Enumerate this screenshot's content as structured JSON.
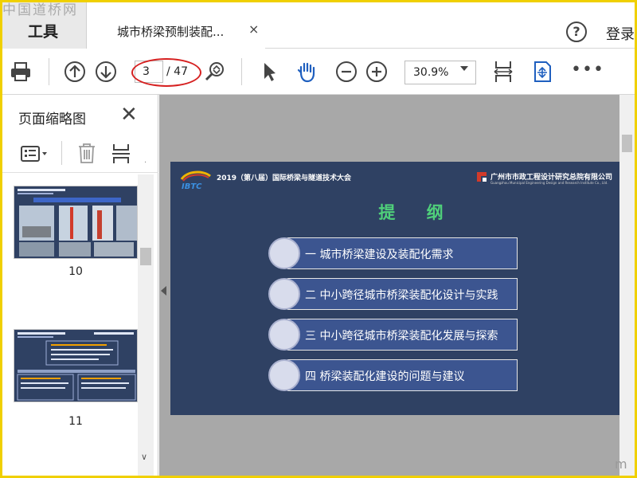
{
  "watermark_top": "中国道桥网",
  "tabs": {
    "tools_label": "工具",
    "document_title": "城市桥梁预制装配...",
    "close_glyph": "×",
    "help_glyph": "?",
    "login_label": "登录"
  },
  "toolbar": {
    "icons": [
      "print-icon",
      "prev-page-icon",
      "next-page-icon",
      "page-zoom-icon",
      "select-arrow-icon",
      "hand-icon",
      "zoom-out-icon",
      "zoom-in-icon",
      "fit-page-icon",
      "scroll-mode-icon",
      "more-icon"
    ],
    "current_page": "3",
    "total_pages": "/ 47",
    "zoom_value": "30.9%",
    "more_glyph": "•••"
  },
  "left_panel": {
    "title": "页面缩略图",
    "close_glyph": "✕",
    "dot_glyph": "·",
    "thumbnails": [
      {
        "label": "10"
      },
      {
        "label": "11"
      }
    ]
  },
  "slide": {
    "conference_title": "2019（第八届）国际桥梁与隧道技术大会",
    "ibtc_logo_text": "IBTC",
    "organization": "广州市市政工程设计研究总院有限公司",
    "organization_sub": "Guangzhou Municipal Engineering Design and Research Institute Co., Ltd.",
    "heading": "提 纲",
    "items": [
      {
        "text": "一  城市桥梁建设及装配化需求"
      },
      {
        "text": "二  中小跨径城市桥梁装配化设计与实践"
      },
      {
        "text": "三  中小跨径城市桥梁装配化发展与探索"
      },
      {
        "text": "四  桥梁装配化建设的问题与建议"
      }
    ]
  },
  "watermark_bottom": "m",
  "colors": {
    "frame_border": "#f0d000",
    "slide_bg": "#2f4163",
    "slide_heading": "#4fd07a",
    "outline_box": "#3c5590",
    "annotation_ellipse": "#d62020",
    "document_bg": "#a8a8a8"
  }
}
